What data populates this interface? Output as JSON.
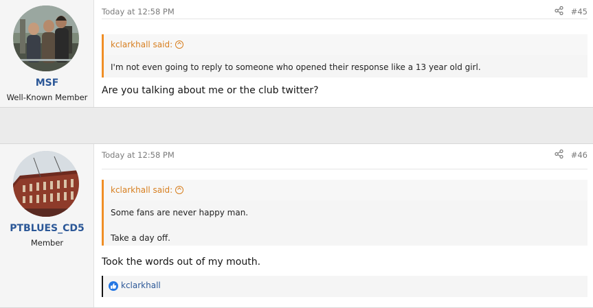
{
  "posts": [
    {
      "username": "MSF",
      "user_title": "Well-Known Member",
      "date": "Today at 12:58 PM",
      "post_number": "#45",
      "quote": {
        "author": "kclarkhall said:",
        "lines": [
          "I'm not even going to reply to someone who opened their response like a 13 year old girl."
        ]
      },
      "message": "Are you talking about me or the club twitter?"
    },
    {
      "username": "PTBLUES_CD5",
      "user_title": "Member",
      "date": "Today at 12:58 PM",
      "post_number": "#46",
      "quote": {
        "author": "kclarkhall said:",
        "lines": [
          "Some fans are never happy man.",
          "Take a day off."
        ]
      },
      "message": "Took the words out of my mouth.",
      "reactions": {
        "icon": "like-icon",
        "users": "kclarkhall"
      }
    }
  ],
  "colors": {
    "username": "#2b5797",
    "quote_accent": "#f08e25",
    "like": "#2577e3"
  }
}
